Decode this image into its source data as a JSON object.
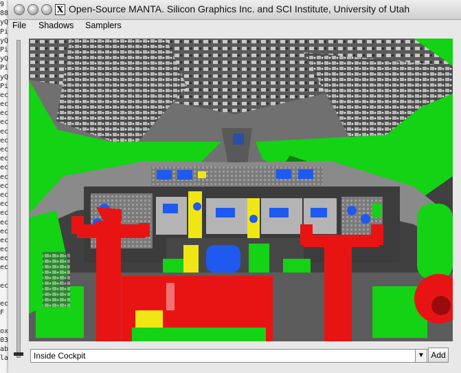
{
  "window": {
    "title": "Open-Source MANTA. Silicon Graphics Inc. and SCI Institute, University of Utah"
  },
  "menubar": {
    "items": [
      "File",
      "Shadows",
      "Samplers"
    ]
  },
  "background_terminal": {
    "lines": [
      "9",
      "88",
      "yQ",
      "Pi",
      "yQ",
      "Pi",
      "yQ",
      "Pi",
      "yQ",
      "Pi",
      "ec",
      "ec",
      "ec",
      "ec",
      "ec",
      "ec",
      "ec",
      "ec",
      "ec",
      "ec",
      "ec",
      "ec",
      "ec",
      "ec",
      "ec",
      "ec",
      "ec",
      "ec",
      "ec",
      "ec",
      "",
      "ect",
      "",
      "ec",
      "F",
      "",
      "ox",
      "03",
      "ab",
      "la"
    ]
  },
  "camera_selector": {
    "selected": "Inside Cockpit"
  },
  "buttons": {
    "add": "Add"
  },
  "icons": {
    "combo_arrow": "▼",
    "resize": "◢"
  },
  "colors": {
    "red": "#e81414",
    "green": "#14d214",
    "blue": "#1e5af0",
    "yellow": "#f0e614",
    "gray": "#6e6e6e"
  }
}
